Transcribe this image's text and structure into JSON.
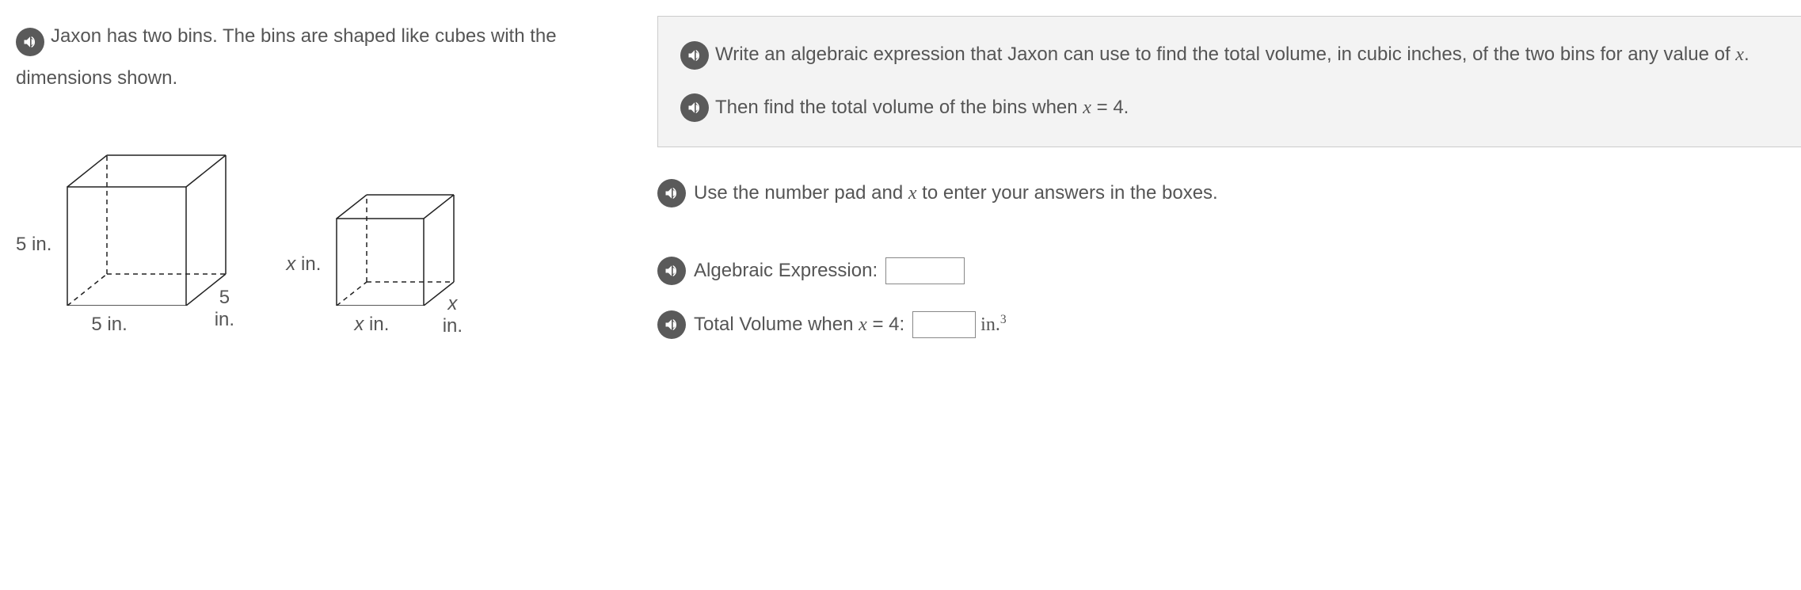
{
  "left": {
    "intro": "Jaxon has two bins. The bins are shaped like cubes with the dimensions shown.",
    "cube1": {
      "side_label": "5 in."
    },
    "cube2": {
      "side_label_var": "x",
      "side_label_unit": " in."
    }
  },
  "right": {
    "prompt_line1_a": "Write an algebraic expression that Jaxon can use to find the total volume, in cubic inches, of the two bins for any value of ",
    "prompt_line1_var": "x",
    "prompt_line1_end": ".",
    "prompt_line2_a": "Then find the total volume of the bins when ",
    "prompt_line2_eq_lhs": "x",
    "prompt_line2_eq_op": " = ",
    "prompt_line2_eq_rhs": "4",
    "prompt_line2_end": ".",
    "instruction_a": "Use the number pad and ",
    "instruction_var": "x",
    "instruction_b": " to enter your answers in the boxes.",
    "answer1_label": "Algebraic Expression:",
    "answer2_label_a": "Total Volume when ",
    "answer2_eq_lhs": "x",
    "answer2_eq_op": " = ",
    "answer2_eq_rhs": "4",
    "answer2_label_end": ":",
    "answer2_unit_base": "in.",
    "answer2_unit_exp": "3"
  }
}
